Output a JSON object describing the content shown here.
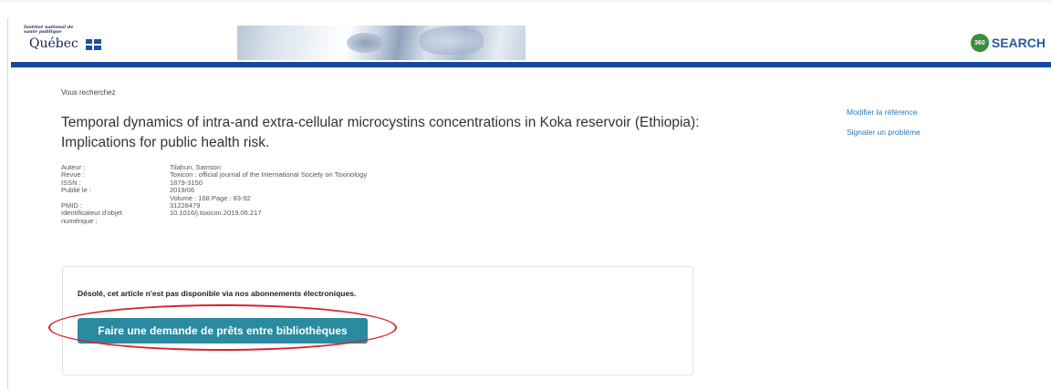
{
  "header": {
    "logo_small_text": "Institut national de santé publique",
    "logo_main_text": "Québec",
    "brand_badge": "360",
    "brand_text": "SEARCH"
  },
  "main": {
    "searching_label": "Vous recherchez",
    "title": "Temporal dynamics of intra-and extra-cellular microcystins concentrations in Koka reservoir (Ethiopia): Implications for public health risk.",
    "metadata": [
      {
        "label": "Auteur :",
        "value": "Tilahun, Samson"
      },
      {
        "label": "Revue :",
        "value": "Toxicon : official journal of the International Society on Toxinology"
      },
      {
        "label": "ISSN :",
        "value": "1879-3150"
      },
      {
        "label": "Publié le :",
        "value": "2019/06"
      },
      {
        "label": "",
        "value": "Volume : 168   Page : 83-92"
      },
      {
        "label": "PMID :",
        "value": "31228479"
      },
      {
        "label": "Identificateur d'objet",
        "value": "10.1016/j.toxicon.2019.06.217"
      },
      {
        "label": "numérique :",
        "value": ""
      }
    ]
  },
  "side_links": {
    "modify_reference": "Modifier la référence",
    "report_problem": "Signaler un problème"
  },
  "availability": {
    "message": "Désolé, cet article n'est pas disponible via nos abonnements électroniques.",
    "ill_button_label": "Faire une demande de prêts entre bibliothèques"
  },
  "colors": {
    "header_bar": "#17479e",
    "button": "#2a8aa0",
    "link": "#2a7ab9",
    "highlight": "#d9232f"
  }
}
